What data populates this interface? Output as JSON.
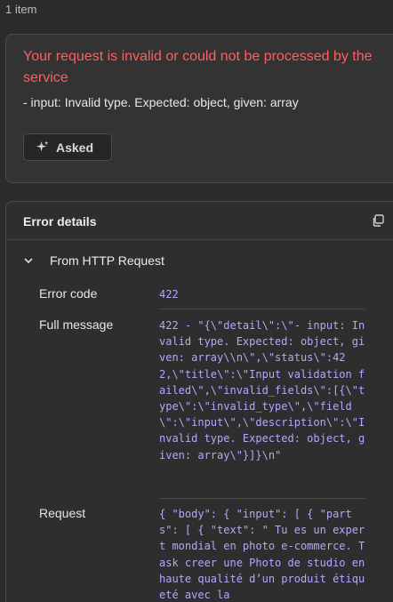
{
  "header": {
    "count": "1 item"
  },
  "error_card": {
    "title": "Your request is invalid or could not be processed by the service",
    "subtitle": "- input: Invalid type. Expected: object, given: array",
    "asked_label": "Asked"
  },
  "details": {
    "title": "Error details",
    "section": "From HTTP Request",
    "rows": [
      {
        "key": "Error code",
        "value": "422"
      },
      {
        "key": "Full message",
        "value": "422 - \"{\\\"detail\\\":\\\"- input: Invalid type. Expected: object, given: array\\\\n\\\",\\\"status\\\":422,\\\"title\\\":\\\"Input validation failed\\\",\\\"invalid_fields\\\":[{\\\"type\\\":\\\"invalid_type\\\",\\\"field\\\":\\\"input\\\",\\\"description\\\":\\\"Invalid type. Expected: object, given: array\\\"}]}\\n\""
      },
      {
        "key": "Request",
        "value": "{ \"body\": { \"input\": [ { \"parts\": [ { \"text\": \" Tu es un expert mondial en photo e-commerce. Task creer une Photo de studio en haute qualité d’un produit étiqueté avec la"
      }
    ]
  }
}
